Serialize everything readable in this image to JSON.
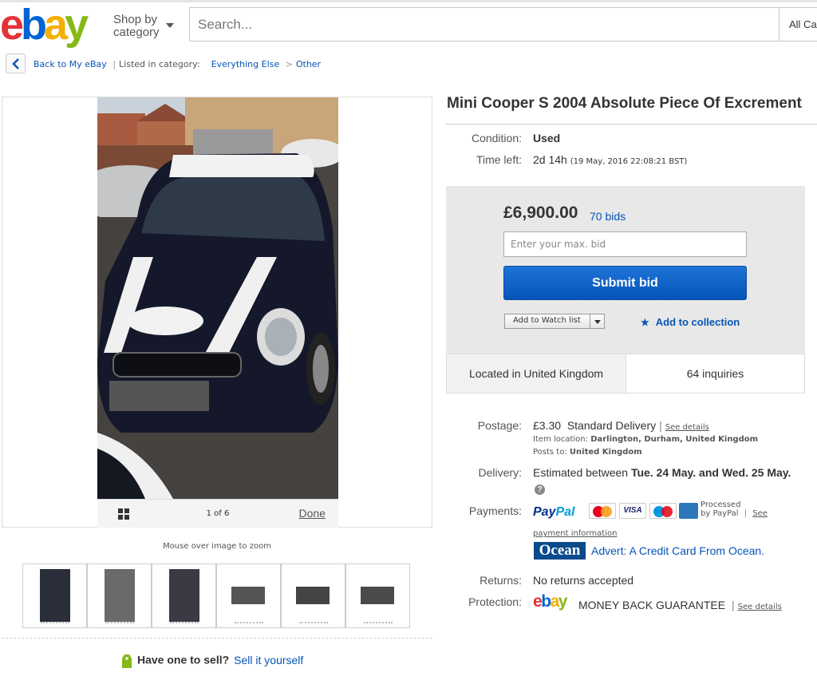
{
  "header": {
    "logo_letters": [
      "e",
      "b",
      "a",
      "y"
    ],
    "shop_by_line1": "Shop by",
    "shop_by_line2": "category",
    "search_placeholder": "Search...",
    "category_select": "All Ca"
  },
  "breadcrumb": {
    "back": "Back to My eBay",
    "separator": "|",
    "listed_label": "Listed in category:",
    "category": "Everything Else",
    "arrow": ">",
    "subcategory": "Other"
  },
  "gallery": {
    "page_count": "1 of 6",
    "done": "Done",
    "zoom_hint": "Mouse over image to zoom",
    "thumbnail_count": 6
  },
  "sell": {
    "prompt": "Have one to sell?",
    "link": "Sell it yourself"
  },
  "item": {
    "title": "Mini Cooper S 2004 Absolute Piece Of Excrement",
    "condition_label": "Condition:",
    "condition": "Used",
    "time_left_label": "Time left:",
    "time_left": "2d 14h",
    "end_time": "(19 May, 2016   22:08:21 BST)"
  },
  "bid": {
    "price": "£6,900.00",
    "bids": "70 bids",
    "max_bid_placeholder": "Enter your max. bid",
    "submit": "Submit bid",
    "watch_list": "Add to Watch list",
    "add_collection": "Add to collection",
    "located": "Located in United Kingdom",
    "inquiries": "64 inquiries"
  },
  "details": {
    "postage_label": "Postage:",
    "postage_cost": "£3.30",
    "postage_type": "Standard Delivery",
    "see_details": "See details",
    "item_location_label": "Item location:",
    "item_location": "Darlington, Durham, United Kingdom",
    "posts_to_label": "Posts to:",
    "posts_to": "United Kingdom",
    "delivery_label": "Delivery:",
    "delivery_prefix": "Estimated between",
    "delivery_dates": "Tue. 24 May. and Wed. 25 May.",
    "payments_label": "Payments:",
    "paypal_part1": "Pay",
    "paypal_part2": "Pal",
    "card_visa": "VISA",
    "processed_line1": "Processed",
    "processed_line2": "by PayPal",
    "see": "See",
    "payment_information": "payment information",
    "ocean_logo": "Ocean",
    "advert": "Advert: A Credit Card From Ocean.",
    "returns_label": "Returns:",
    "returns": "No returns accepted",
    "protection_label": "Protection:",
    "money_back": "MONEY BACK GUARANTEE",
    "see_details_2": "See details"
  },
  "icons": [
    "chevron-left-icon",
    "grid-icon",
    "star-icon",
    "help-icon",
    "tag-icon",
    "chevron-down-icon"
  ],
  "colors": {
    "link": "#0654ba",
    "submit": "#0654ba",
    "ebay_e": "#e53238",
    "ebay_b": "#0064d2",
    "ebay_a": "#f5af02",
    "ebay_y": "#86b817"
  }
}
